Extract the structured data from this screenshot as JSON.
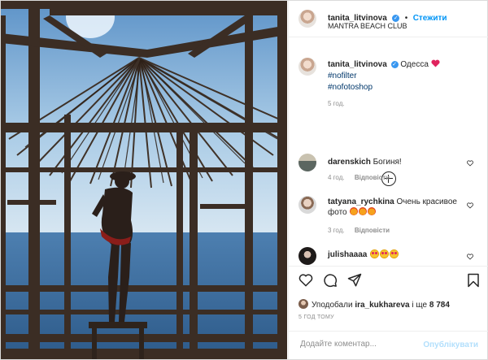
{
  "post": {
    "username": "tanita_litvinova",
    "follow_label": "Стежити",
    "location": "MANTRA BEACH CLUB",
    "separator": "•"
  },
  "caption": {
    "username": "tanita_litvinova",
    "text": "Одесса",
    "hashtags": [
      "#nofilter",
      "#nofotoshop"
    ],
    "time_ago": "5 год."
  },
  "comments": [
    {
      "username": "darenskich",
      "text": "Богиня!",
      "time_ago": "4 год.",
      "reply_label": "Відповісти"
    },
    {
      "username": "tatyana_rychkina",
      "text": "Очень красивое фото",
      "time_ago": "3 год.",
      "reply_label": "Відповісти"
    },
    {
      "username": "julishaaaa",
      "text": ""
    }
  ],
  "likes": {
    "prefix": "Уподобали",
    "user": "ira_kukhareva",
    "suffix": "і ще",
    "count": "8 784"
  },
  "posted_time": "5 ГОД ТОМУ",
  "add_comment": {
    "placeholder": "Додайте коментар...",
    "publish_label": "Опублікувати"
  },
  "colors": {
    "accent": "#0095f6",
    "link": "#00376b",
    "muted": "#8e8e8e",
    "heart": "#e0245e"
  },
  "icons": [
    "heart-icon",
    "comment-icon",
    "share-icon",
    "bookmark-icon",
    "plus-circle-icon",
    "verified-icon"
  ]
}
